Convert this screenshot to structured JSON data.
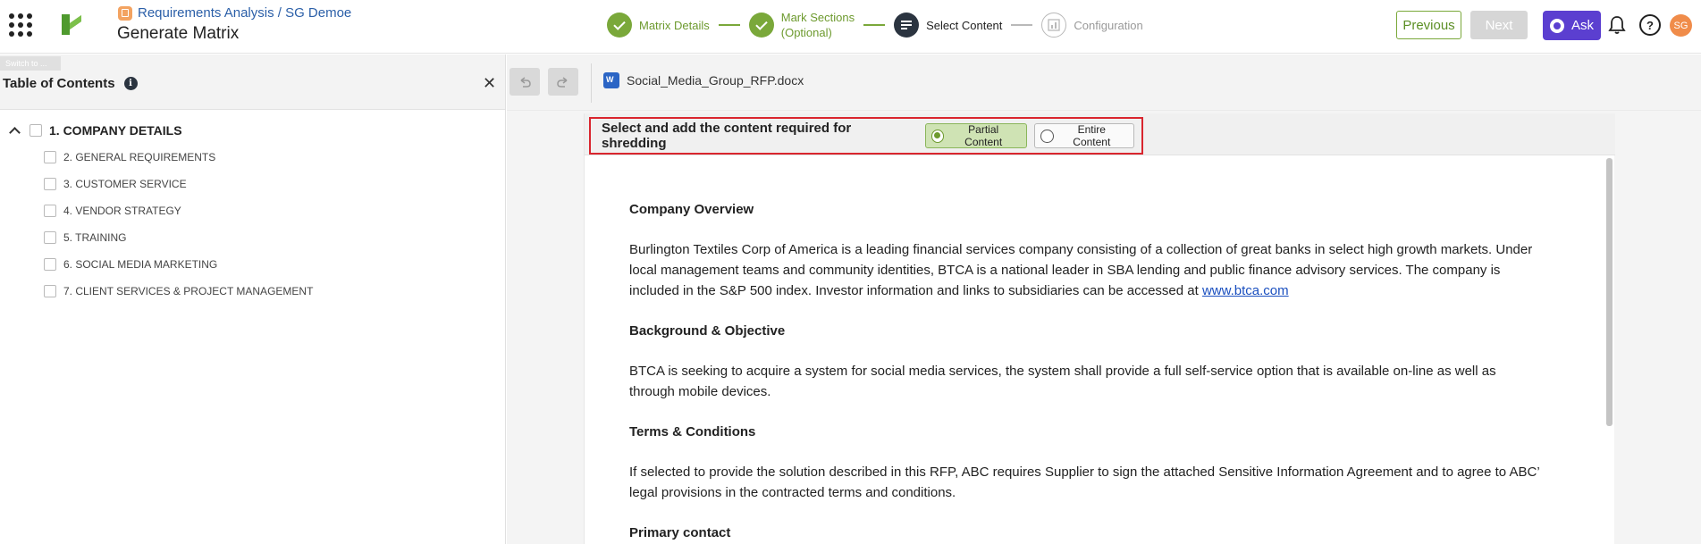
{
  "header": {
    "breadcrumb": "Requirements Analysis / SG Demoe",
    "title": "Generate Matrix"
  },
  "stepper": {
    "steps": [
      {
        "label": "Matrix Details",
        "state": "done"
      },
      {
        "label_line1": "Mark Sections",
        "label_line2": "(Optional)",
        "state": "done"
      },
      {
        "label": "Select Content",
        "state": "active"
      },
      {
        "label": "Configuration",
        "state": "todo"
      }
    ]
  },
  "actions": {
    "previous": "Previous",
    "next": "Next",
    "ask": "Ask",
    "avatar_initials": "SG"
  },
  "sidebar": {
    "switch_label": "Switch to ...",
    "title": "Table of Contents",
    "info_glyph": "i",
    "close_glyph": "✕",
    "items": [
      {
        "label": "1. COMPANY DETAILS",
        "level": 0
      },
      {
        "label": "2. GENERAL REQUIREMENTS",
        "level": 1
      },
      {
        "label": "3. CUSTOMER SERVICE",
        "level": 1
      },
      {
        "label": "4. VENDOR STRATEGY",
        "level": 1
      },
      {
        "label": "5. TRAINING",
        "level": 1
      },
      {
        "label": "6. SOCIAL MEDIA MARKETING",
        "level": 1
      },
      {
        "label": "7. CLIENT SERVICES & PROJECT MANAGEMENT",
        "level": 1
      }
    ]
  },
  "document": {
    "file_name": "Social_Media_Group_RFP.docx",
    "mode_prompt": "Select and add the content required for shredding",
    "mode_options": [
      {
        "label": "Partial Content",
        "selected": true
      },
      {
        "label": "Entire Content",
        "selected": false
      }
    ],
    "sections": [
      {
        "heading": "Company Overview",
        "text": "Burlington Textiles Corp of America is a leading financial services company consisting of a collection of great banks in select high growth markets. Under local management teams and community identities, BTCA is a national leader in SBA lending and public finance advisory services. The company is included in the S&P 500 index. Investor information and links to subsidiaries can be accessed at ",
        "link": "www.btca.com"
      },
      {
        "heading": "Background & Objective",
        "text": "BTCA is seeking to acquire a system for social media services, the system shall provide a full self-service option that is available on-line as well as through mobile devices."
      },
      {
        "heading": "Terms & Conditions",
        "text": "If selected to provide the solution described in this RFP, ABC requires Supplier to sign the attached Sensitive Information Agreement and to agree to ABC’ legal provisions in the contracted terms and conditions."
      },
      {
        "heading": "Primary contact"
      }
    ]
  },
  "colors": {
    "accent_green": "#7aa83a",
    "ask_purple": "#5b3fd0",
    "highlight_red": "#d9252e",
    "avatar_orange": "#f08c4a"
  }
}
